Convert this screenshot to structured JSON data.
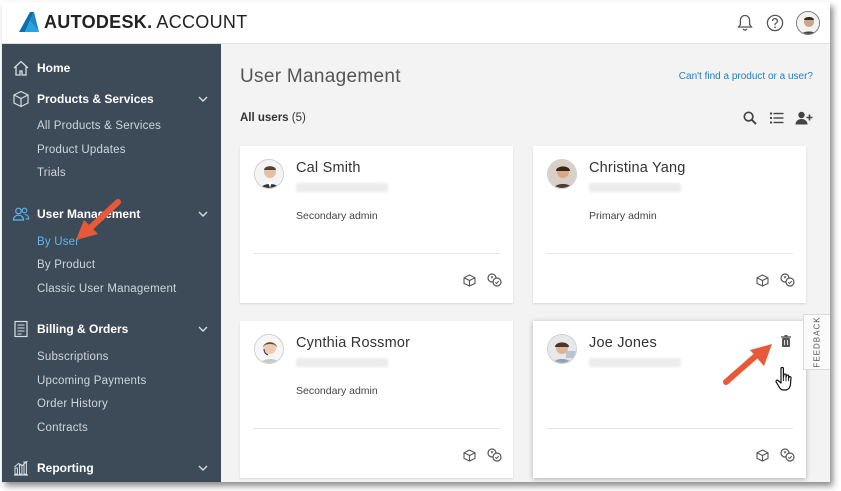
{
  "app": {
    "brand_word": "AUTODESK.",
    "brand_suffix": "ACCOUNT"
  },
  "header": {
    "icons": [
      "bell-icon",
      "help-icon",
      "user-avatar"
    ]
  },
  "sidebar": {
    "groups": [
      {
        "label": "Home",
        "icon": "home-icon"
      },
      {
        "label": "Products & Services",
        "icon": "box-icon",
        "items": [
          "All Products & Services",
          "Product Updates",
          "Trials"
        ]
      },
      {
        "label": "User Management",
        "icon": "users-icon",
        "items": [
          "By User",
          "By Product",
          "Classic User Management"
        ],
        "active_item": "By User"
      },
      {
        "label": "Billing & Orders",
        "icon": "receipt-icon",
        "items": [
          "Subscriptions",
          "Upcoming Payments",
          "Order History",
          "Contracts"
        ]
      },
      {
        "label": "Reporting",
        "icon": "chart-icon"
      }
    ]
  },
  "main": {
    "title": "User Management",
    "help_link": "Can't find a product or a user?",
    "filter_label": "All users",
    "filter_count": "(5)",
    "tools": [
      "search-icon",
      "list-view-icon",
      "add-user-icon"
    ],
    "feedback_label": "FEEDBACK",
    "users": [
      {
        "name": "Cal Smith",
        "role": "Secondary admin"
      },
      {
        "name": "Christina Yang",
        "role": "Primary admin"
      },
      {
        "name": "Cynthia Rossmor",
        "role": "Secondary admin"
      },
      {
        "name": "Joe Jones",
        "role": ""
      }
    ]
  },
  "colors": {
    "sidebar_bg": "#3d4a58",
    "active_link": "#5fb6f0",
    "link": "#1b7dc8",
    "annotation_arrow": "#e8593a"
  }
}
